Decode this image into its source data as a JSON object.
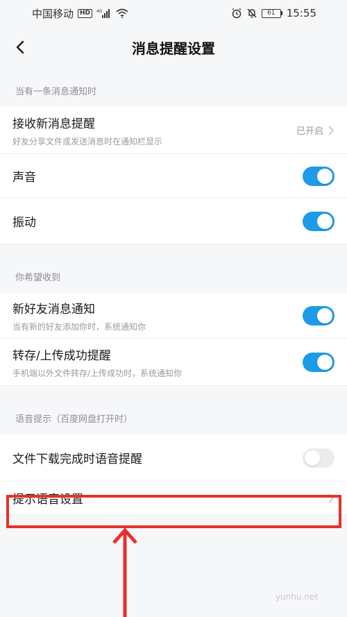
{
  "status_bar": {
    "carrier": "中国移动",
    "hd_label": "HD",
    "signal_label": "4G",
    "battery_level": "61",
    "time": "15:55"
  },
  "nav": {
    "title": "消息提醒设置"
  },
  "sections": {
    "s1_header": "当有一条消息通知时",
    "s2_header": "你希望收到",
    "s3_header": "语音提示（百度网盘打开时）"
  },
  "rows": {
    "receive": {
      "title": "接收新消息提醒",
      "subtitle": "好友分享文件或发送消息时在通知栏显示",
      "status": "已开启"
    },
    "sound": {
      "title": "声音",
      "enabled": true
    },
    "vibrate": {
      "title": "振动",
      "enabled": true
    },
    "new_friend": {
      "title": "新好友消息通知",
      "subtitle": "当有新的好友添加你时，系统通知你",
      "enabled": true
    },
    "transfer": {
      "title": "转存/上传成功提醒",
      "subtitle": "手机端以外文件转存/上传成功时，系统通知你",
      "enabled": true
    },
    "download_voice": {
      "title": "文件下载完成时语音提醒",
      "enabled": false
    },
    "voice_settings": {
      "title": "提示语音设置"
    }
  },
  "watermark": "yunhu.net",
  "colors": {
    "toggle_on": "#1e9be8",
    "toggle_off": "#ececef",
    "highlight": "#e8302a"
  }
}
